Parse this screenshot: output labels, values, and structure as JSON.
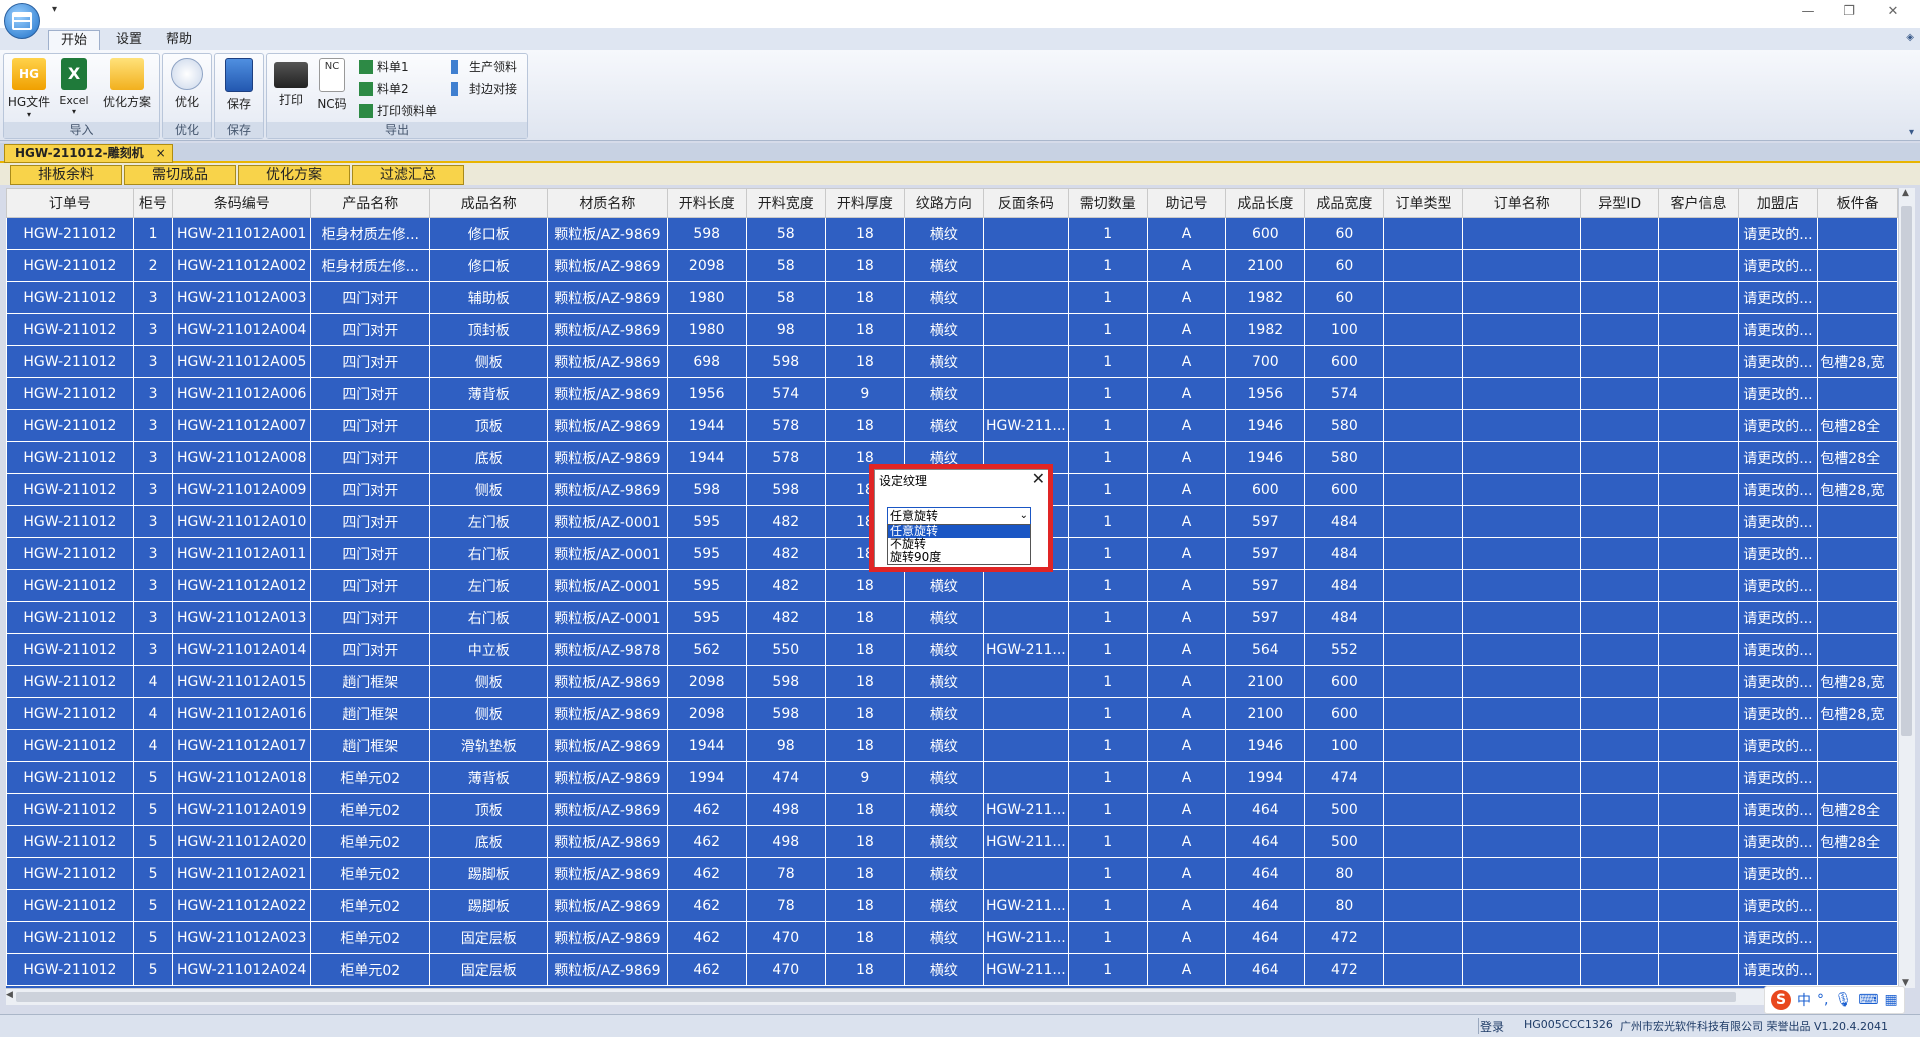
{
  "menu_tabs": [
    "开始",
    "设置",
    "帮助"
  ],
  "ribbon": {
    "import": {
      "label": "导入",
      "hg": "HG文件",
      "excel": "Excel",
      "scheme": "优化方案"
    },
    "optimize": {
      "label": "优化",
      "btn": "优化"
    },
    "save": {
      "label": "保存",
      "btn": "保存"
    },
    "export": {
      "label": "导出",
      "print": "打印",
      "nc": "NC码",
      "nc_icon": "NC",
      "bom1": "料单1",
      "bom2": "料单2",
      "print_bom": "打印领料单",
      "prod_bom": "生产领料",
      "edge": "封边对接"
    },
    "excel_icon": "X",
    "hg_icon": "HG"
  },
  "doc_tab": {
    "label": "HGW-211012-雕刻机",
    "close": "×"
  },
  "sub_tabs": [
    "排板余料",
    "需切成品",
    "优化方案",
    "过滤汇总"
  ],
  "columns": [
    "订单号",
    "柜号",
    "条码编号",
    "产品名称",
    "成品名称",
    "材质名称",
    "开料长度",
    "开料宽度",
    "开料厚度",
    "纹路方向",
    "反面条码",
    "需切数量",
    "助记号",
    "成品长度",
    "成品宽度",
    "订单类型",
    "订单名称",
    "异型ID",
    "客户信息",
    "加盟店",
    "板件备"
  ],
  "rows": [
    [
      "HGW-211012",
      "1",
      "HGW-211012A001",
      "柜身材质左修...",
      "修口板",
      "颗粒板/AZ-9869",
      "598",
      "58",
      "18",
      "横纹",
      "",
      "1",
      "A",
      "600",
      "60",
      "",
      "",
      "",
      "",
      "请更改的...",
      ""
    ],
    [
      "HGW-211012",
      "2",
      "HGW-211012A002",
      "柜身材质左修...",
      "修口板",
      "颗粒板/AZ-9869",
      "2098",
      "58",
      "18",
      "横纹",
      "",
      "1",
      "A",
      "2100",
      "60",
      "",
      "",
      "",
      "",
      "请更改的...",
      ""
    ],
    [
      "HGW-211012",
      "3",
      "HGW-211012A003",
      "四门对开",
      "辅助板",
      "颗粒板/AZ-9869",
      "1980",
      "58",
      "18",
      "横纹",
      "",
      "1",
      "A",
      "1982",
      "60",
      "",
      "",
      "",
      "",
      "请更改的...",
      ""
    ],
    [
      "HGW-211012",
      "3",
      "HGW-211012A004",
      "四门对开",
      "顶封板",
      "颗粒板/AZ-9869",
      "1980",
      "98",
      "18",
      "横纹",
      "",
      "1",
      "A",
      "1982",
      "100",
      "",
      "",
      "",
      "",
      "请更改的...",
      ""
    ],
    [
      "HGW-211012",
      "3",
      "HGW-211012A005",
      "四门对开",
      "侧板",
      "颗粒板/AZ-9869",
      "698",
      "598",
      "18",
      "横纹",
      "",
      "1",
      "A",
      "700",
      "600",
      "",
      "",
      "",
      "",
      "请更改的...",
      "包槽28,宽"
    ],
    [
      "HGW-211012",
      "3",
      "HGW-211012A006",
      "四门对开",
      "薄背板",
      "颗粒板/AZ-9869",
      "1956",
      "574",
      "9",
      "横纹",
      "",
      "1",
      "A",
      "1956",
      "574",
      "",
      "",
      "",
      "",
      "请更改的...",
      ""
    ],
    [
      "HGW-211012",
      "3",
      "HGW-211012A007",
      "四门对开",
      "顶板",
      "颗粒板/AZ-9869",
      "1944",
      "578",
      "18",
      "横纹",
      "HGW-211...",
      "1",
      "A",
      "1946",
      "580",
      "",
      "",
      "",
      "",
      "请更改的...",
      "包槽28全"
    ],
    [
      "HGW-211012",
      "3",
      "HGW-211012A008",
      "四门对开",
      "底板",
      "颗粒板/AZ-9869",
      "1944",
      "578",
      "18",
      "横纹",
      "",
      "1",
      "A",
      "1946",
      "580",
      "",
      "",
      "",
      "",
      "请更改的...",
      "包槽28全"
    ],
    [
      "HGW-211012",
      "3",
      "HGW-211012A009",
      "四门对开",
      "侧板",
      "颗粒板/AZ-9869",
      "598",
      "598",
      "18",
      "横纹",
      "",
      "1",
      "A",
      "600",
      "600",
      "",
      "",
      "",
      "",
      "请更改的...",
      "包槽28,宽"
    ],
    [
      "HGW-211012",
      "3",
      "HGW-211012A010",
      "四门对开",
      "左门板",
      "颗粒板/AZ-0001",
      "595",
      "482",
      "18",
      "横纹",
      "",
      "1",
      "A",
      "597",
      "484",
      "",
      "",
      "",
      "",
      "请更改的...",
      ""
    ],
    [
      "HGW-211012",
      "3",
      "HGW-211012A011",
      "四门对开",
      "右门板",
      "颗粒板/AZ-0001",
      "595",
      "482",
      "18",
      "横纹",
      "",
      "1",
      "A",
      "597",
      "484",
      "",
      "",
      "",
      "",
      "请更改的...",
      ""
    ],
    [
      "HGW-211012",
      "3",
      "HGW-211012A012",
      "四门对开",
      "左门板",
      "颗粒板/AZ-0001",
      "595",
      "482",
      "18",
      "横纹",
      "",
      "1",
      "A",
      "597",
      "484",
      "",
      "",
      "",
      "",
      "请更改的...",
      ""
    ],
    [
      "HGW-211012",
      "3",
      "HGW-211012A013",
      "四门对开",
      "右门板",
      "颗粒板/AZ-0001",
      "595",
      "482",
      "18",
      "横纹",
      "",
      "1",
      "A",
      "597",
      "484",
      "",
      "",
      "",
      "",
      "请更改的...",
      ""
    ],
    [
      "HGW-211012",
      "3",
      "HGW-211012A014",
      "四门对开",
      "中立板",
      "颗粒板/AZ-9878",
      "562",
      "550",
      "18",
      "横纹",
      "HGW-211...",
      "1",
      "A",
      "564",
      "552",
      "",
      "",
      "",
      "",
      "请更改的...",
      ""
    ],
    [
      "HGW-211012",
      "4",
      "HGW-211012A015",
      "趟门框架",
      "侧板",
      "颗粒板/AZ-9869",
      "2098",
      "598",
      "18",
      "横纹",
      "",
      "1",
      "A",
      "2100",
      "600",
      "",
      "",
      "",
      "",
      "请更改的...",
      "包槽28,宽"
    ],
    [
      "HGW-211012",
      "4",
      "HGW-211012A016",
      "趟门框架",
      "侧板",
      "颗粒板/AZ-9869",
      "2098",
      "598",
      "18",
      "横纹",
      "",
      "1",
      "A",
      "2100",
      "600",
      "",
      "",
      "",
      "",
      "请更改的...",
      "包槽28,宽"
    ],
    [
      "HGW-211012",
      "4",
      "HGW-211012A017",
      "趟门框架",
      "滑轨垫板",
      "颗粒板/AZ-9869",
      "1944",
      "98",
      "18",
      "横纹",
      "",
      "1",
      "A",
      "1946",
      "100",
      "",
      "",
      "",
      "",
      "请更改的...",
      ""
    ],
    [
      "HGW-211012",
      "5",
      "HGW-211012A018",
      "柜单元02",
      "薄背板",
      "颗粒板/AZ-9869",
      "1994",
      "474",
      "9",
      "横纹",
      "",
      "1",
      "A",
      "1994",
      "474",
      "",
      "",
      "",
      "",
      "请更改的...",
      ""
    ],
    [
      "HGW-211012",
      "5",
      "HGW-211012A019",
      "柜单元02",
      "顶板",
      "颗粒板/AZ-9869",
      "462",
      "498",
      "18",
      "横纹",
      "HGW-211...",
      "1",
      "A",
      "464",
      "500",
      "",
      "",
      "",
      "",
      "请更改的...",
      "包槽28全"
    ],
    [
      "HGW-211012",
      "5",
      "HGW-211012A020",
      "柜单元02",
      "底板",
      "颗粒板/AZ-9869",
      "462",
      "498",
      "18",
      "横纹",
      "HGW-211...",
      "1",
      "A",
      "464",
      "500",
      "",
      "",
      "",
      "",
      "请更改的...",
      "包槽28全"
    ],
    [
      "HGW-211012",
      "5",
      "HGW-211012A021",
      "柜单元02",
      "踢脚板",
      "颗粒板/AZ-9869",
      "462",
      "78",
      "18",
      "横纹",
      "",
      "1",
      "A",
      "464",
      "80",
      "",
      "",
      "",
      "",
      "请更改的...",
      ""
    ],
    [
      "HGW-211012",
      "5",
      "HGW-211012A022",
      "柜单元02",
      "踢脚板",
      "颗粒板/AZ-9869",
      "462",
      "78",
      "18",
      "横纹",
      "HGW-211...",
      "1",
      "A",
      "464",
      "80",
      "",
      "",
      "",
      "",
      "请更改的...",
      ""
    ],
    [
      "HGW-211012",
      "5",
      "HGW-211012A023",
      "柜单元02",
      "固定层板",
      "颗粒板/AZ-9869",
      "462",
      "470",
      "18",
      "横纹",
      "HGW-211...",
      "1",
      "A",
      "464",
      "472",
      "",
      "",
      "",
      "",
      "请更改的...",
      ""
    ],
    [
      "HGW-211012",
      "5",
      "HGW-211012A024",
      "柜单元02",
      "固定层板",
      "颗粒板/AZ-9869",
      "462",
      "470",
      "18",
      "横纹",
      "HGW-211...",
      "1",
      "A",
      "464",
      "472",
      "",
      "",
      "",
      "",
      "请更改的...",
      ""
    ]
  ],
  "dialog": {
    "title": "设定纹理",
    "close": "✕",
    "selected": "任意旋转",
    "options": [
      "任意旋转",
      "不旋转",
      "旋转90度"
    ]
  },
  "status": {
    "login": "登录",
    "code": "HG005CCC1326",
    "company": "广州市宏光软件科技有限公司 荣誉出品 V1.20.4.2041"
  },
  "ime": {
    "logo": "S",
    "lang": "中"
  },
  "colors": {
    "selection": "#2f5fc2",
    "tab_yellow": "#f8d34a",
    "highlight_red": "#e02525"
  }
}
